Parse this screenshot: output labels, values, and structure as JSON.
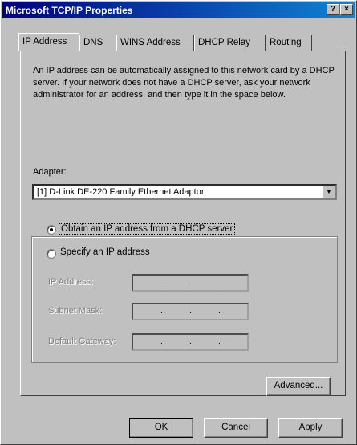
{
  "window": {
    "title": "Microsoft TCP/IP Properties",
    "help_button": "?",
    "close_button": "×"
  },
  "tabs": [
    {
      "label": "IP Address",
      "active": true
    },
    {
      "label": "DNS"
    },
    {
      "label": "WINS Address"
    },
    {
      "label": "DHCP Relay"
    },
    {
      "label": "Routing"
    }
  ],
  "description": "An IP address can be automatically assigned to this network card by a DHCP server.  If your network does not have a DHCP server, ask your network administrator for an address, and then type it in the space below.",
  "adapter": {
    "label": "Adapter:",
    "selected": "[1] D-Link DE-220 Family Ethernet Adaptor"
  },
  "options": {
    "obtain": "Obtain an IP address from a DHCP server",
    "specify": "Specify an IP address",
    "selected": "obtain"
  },
  "fields": {
    "ip_label": "IP Address:",
    "subnet_label": "Subnet Mask:",
    "gateway_label": "Default Gateway:",
    "dot": "."
  },
  "buttons": {
    "advanced": "Advanced...",
    "ok": "OK",
    "cancel": "Cancel",
    "apply": "Apply"
  }
}
